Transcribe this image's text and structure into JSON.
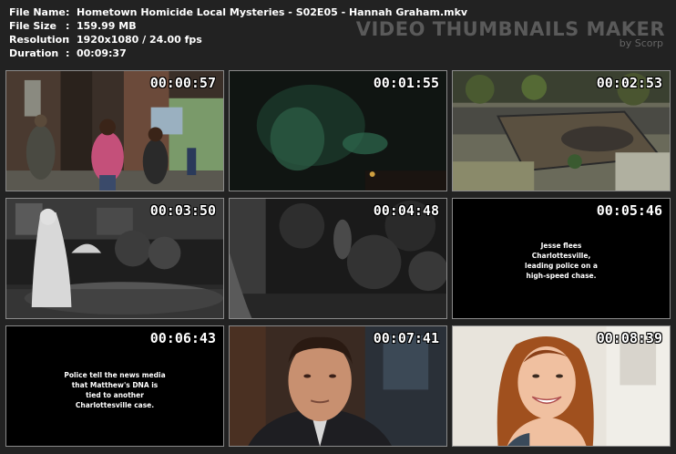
{
  "info": {
    "rows": [
      {
        "key": "File Name",
        "value": "Hometown Homicide Local Mysteries - S02E05 - Hannah Graham.mkv"
      },
      {
        "key": "File Size",
        "value": "159.99 MB"
      },
      {
        "key": "Resolution",
        "value": "1920x1080 / 24.00 fps"
      },
      {
        "key": "Duration",
        "value": "00:09:37"
      }
    ],
    "separator": ":"
  },
  "brand": {
    "title": "VIDEO THUMBNAILS MAKER",
    "subtitle": "by Scorp"
  },
  "thumbnails": [
    {
      "timestamp": "00:00:57",
      "scene": "street-walkers"
    },
    {
      "timestamp": "00:01:55",
      "scene": "dark-green"
    },
    {
      "timestamp": "00:02:53",
      "scene": "night-patio-cam"
    },
    {
      "timestamp": "00:03:50",
      "scene": "bw-figure"
    },
    {
      "timestamp": "00:04:48",
      "scene": "bw-garden"
    },
    {
      "timestamp": "00:05:46",
      "scene": "text-card",
      "caption": [
        "Jesse flees",
        "Charlottesville,",
        "leading police on a",
        "high-speed chase."
      ]
    },
    {
      "timestamp": "00:06:43",
      "scene": "text-card",
      "caption": [
        "Police tell the news media",
        "that Matthew's DNA is",
        "tied to another",
        "Charlottesville case."
      ]
    },
    {
      "timestamp": "00:07:41",
      "scene": "man-portrait"
    },
    {
      "timestamp": "00:08:39",
      "scene": "woman-portrait"
    }
  ]
}
